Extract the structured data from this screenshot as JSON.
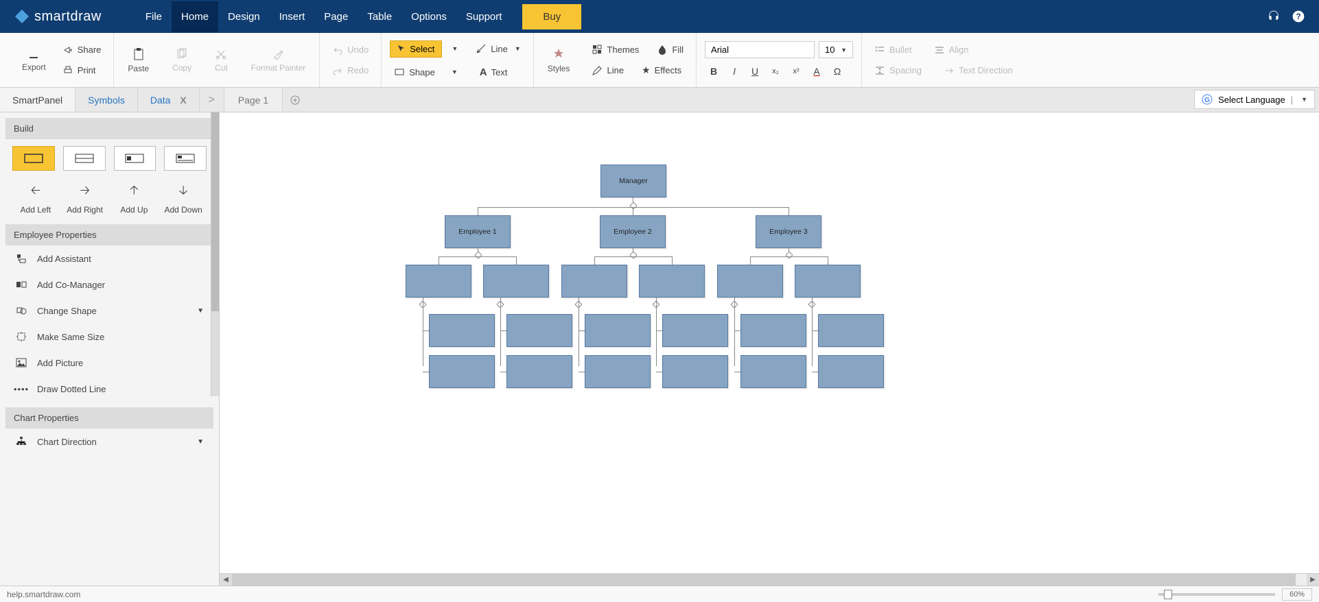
{
  "app": {
    "name": "smartdraw"
  },
  "menu": {
    "items": [
      "File",
      "Home",
      "Design",
      "Insert",
      "Page",
      "Table",
      "Options",
      "Support"
    ],
    "active": "Home",
    "buy": "Buy"
  },
  "ribbon": {
    "export": "Export",
    "share": "Share",
    "print": "Print",
    "paste": "Paste",
    "copy": "Copy",
    "cut": "Cut",
    "format_painter": "Format Painter",
    "undo": "Undo",
    "redo": "Redo",
    "select": "Select",
    "line": "Line",
    "shape": "Shape",
    "text": "Text",
    "styles": "Styles",
    "themes": "Themes",
    "fill": "Fill",
    "line2": "Line",
    "effects": "Effects",
    "font_name": "Arial",
    "font_size": "10",
    "bullet": "Bullet",
    "align": "Align",
    "spacing": "Spacing",
    "text_direction": "Text Direction"
  },
  "tabs": {
    "smartpanel": "SmartPanel",
    "symbols": "Symbols",
    "data": "Data",
    "page": "Page 1",
    "lang": "Select Language"
  },
  "sidebar": {
    "build": "Build",
    "add_left": "Add Left",
    "add_right": "Add Right",
    "add_up": "Add Up",
    "add_down": "Add Down",
    "emp_props": "Employee Properties",
    "add_assistant": "Add Assistant",
    "add_comanager": "Add Co-Manager",
    "change_shape": "Change Shape",
    "make_same_size": "Make Same Size",
    "add_picture": "Add Picture",
    "draw_dotted": "Draw Dotted Line",
    "chart_props": "Chart Properties",
    "chart_direction": "Chart Direction"
  },
  "org": {
    "manager": "Manager",
    "emp1": "Employee 1",
    "emp2": "Employee 2",
    "emp3": "Employee 3"
  },
  "status": {
    "url": "help.smartdraw.com",
    "zoom": "60%"
  }
}
